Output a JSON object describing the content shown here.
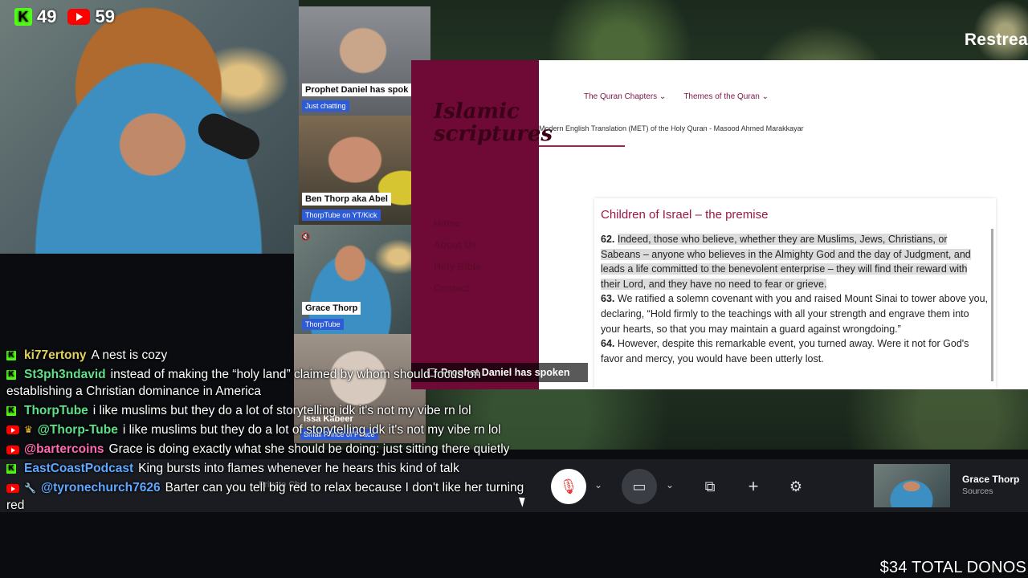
{
  "counters": {
    "kick_count": "49",
    "youtube_count": "59"
  },
  "restream": {
    "brand": "Restrea"
  },
  "participants": [
    {
      "name": "Prophet Daniel has spok",
      "tag": "Just chatting"
    },
    {
      "name": "Ben Thorp aka Abel",
      "tag": "ThorpTube on YT/Kick"
    },
    {
      "name": "Grace Thorp",
      "tag": "ThorpTube"
    },
    {
      "name": "Issa Kabeer",
      "tag": "Small Prince of Peace"
    }
  ],
  "website": {
    "logo_line1": "Islamic",
    "logo_line2": "scriptures",
    "nav": [
      "The Quran Chapters ⌄",
      "Themes of the Quran ⌄"
    ],
    "subtitle": "Modern English Translation (MET) of the Holy Quran - Masood Ahmed Marakkayar",
    "side_menu": [
      "Home",
      "About Us",
      "Holy Bible",
      "Contact"
    ],
    "article_title": "Children of Israel – the premise",
    "verses": [
      {
        "num": "62.",
        "text": "Indeed, those who believe, whether they are Muslims, Jews, Christians, or Sabeans – anyone who believes in the Almighty God and the day of Judgment, and leads a life committed to the benevolent enterprise – they will find their reward with their Lord, and they have no need to fear or grieve."
      },
      {
        "num": "63.",
        "text": "We ratified a solemn covenant with you and raised Mount Sinai to tower above you, declaring, “Hold firmly to the teachings with all your strength and engrave them into your hearts, so that you may maintain a guard against wrongdoing.”"
      },
      {
        "num": "64.",
        "text": "However, despite this remarkable event, you turned away. Were it not for God's favor and mercy, you would have been utterly lost."
      }
    ]
  },
  "spoken_bar": "Prophet Daniel has spoken",
  "controls": {
    "private_chat": "Private Chat"
  },
  "host": {
    "name": "Grace Thorp",
    "sub": "Sources"
  },
  "chat": [
    {
      "platform": "kick",
      "user": "ki77ertony",
      "color": "#e3d25e",
      "text": "A nest is cozy"
    },
    {
      "platform": "kick",
      "user": "St3ph3ndavid",
      "color": "#5fe08a",
      "text": "instead of making the “holy land” claimed by whom should focus on establishing a Christian dominance in America"
    },
    {
      "platform": "kick",
      "user": "ThorpTube",
      "color": "#5fe08a",
      "text": "i like muslims but they do a lot of storytelling idk it's not my vibe rn lol"
    },
    {
      "platform": "youtube",
      "user": "@Thorp-Tube",
      "color": "#5fe08a",
      "text": "i like muslims but they do a lot of storytelling idk it's not my vibe rn lol"
    },
    {
      "platform": "youtube",
      "user": "@bartercoins",
      "color": "#ff6bb0",
      "text": "Grace is doing exactly what she should be doing: just sitting there quietly"
    },
    {
      "platform": "kick",
      "user": "EastCoastPodcast",
      "color": "#5fa8ff",
      "text": "King bursts into flames whenever he hears this kind of talk"
    },
    {
      "platform": "youtube",
      "user": "@tyronechurch7626",
      "color": "#5fa8ff",
      "text": "Barter can you tell big red to relax because I don't like her turning red"
    }
  ],
  "donos": "$34 TOTAL DONOS"
}
